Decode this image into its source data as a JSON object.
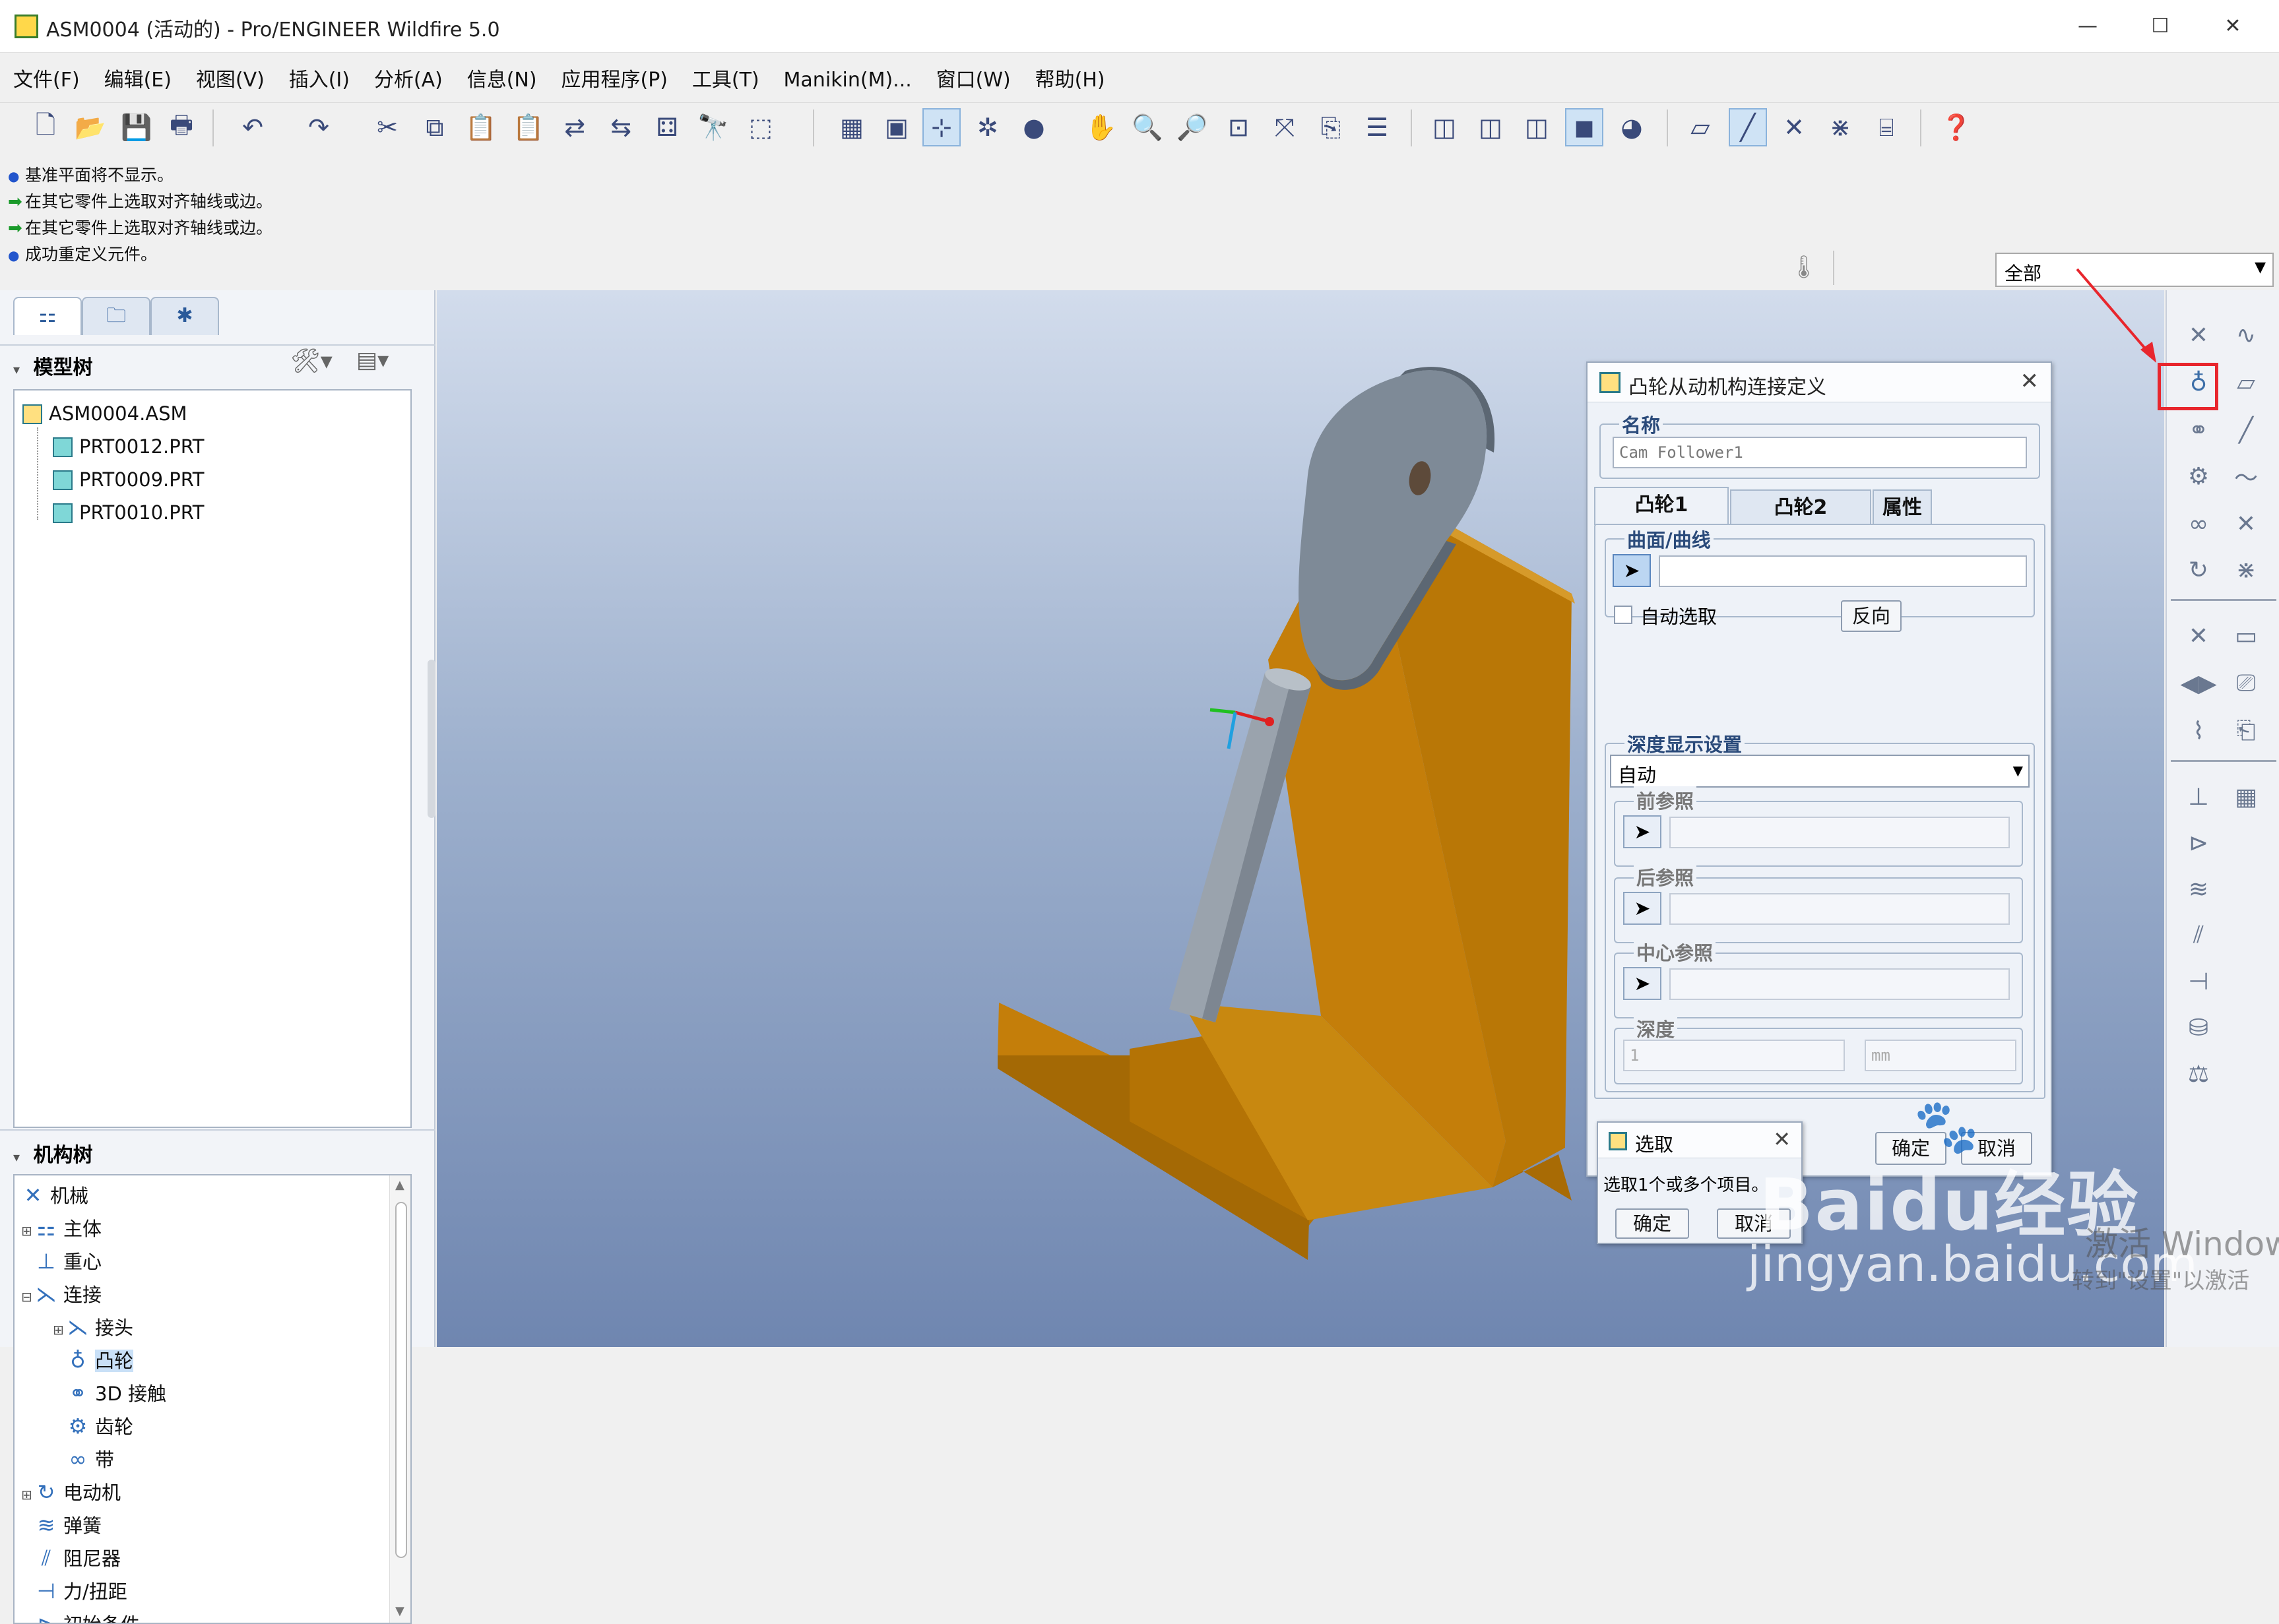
{
  "window": {
    "title": "ASM0004 (活动的) - Pro/ENGINEER Wildfire 5.0",
    "minimize_glyph": "—",
    "maximize_glyph": "☐",
    "close_glyph": "✕"
  },
  "menu": [
    "文件(F)",
    "编辑(E)",
    "视图(V)",
    "插入(I)",
    "分析(A)",
    "信息(N)",
    "应用程序(P)",
    "工具(T)",
    "Manikin(M)...",
    "窗口(W)",
    "帮助(H)"
  ],
  "messages": [
    {
      "kind": "info",
      "text": "基准平面将不显示。"
    },
    {
      "kind": "prompt",
      "text": "在其它零件上选取对齐轴线或边。"
    },
    {
      "kind": "prompt",
      "text": "在其它零件上选取对齐轴线或边。"
    },
    {
      "kind": "info",
      "text": "成功重定义元件。"
    }
  ],
  "filter": {
    "value": "全部"
  },
  "model_tree": {
    "header": "模型树",
    "items": [
      {
        "label": "ASM0004.ASM",
        "icon": "assembly-icon"
      },
      {
        "label": "PRT0012.PRT",
        "icon": "part-icon"
      },
      {
        "label": "PRT0009.PRT",
        "icon": "part-icon"
      },
      {
        "label": "PRT0010.PRT",
        "icon": "part-icon"
      }
    ]
  },
  "mechanism_tree": {
    "header": "机构树",
    "items": [
      {
        "label": "机械",
        "icon": "mechanism-icon",
        "level": 0
      },
      {
        "label": "主体",
        "icon": "body-icon",
        "level": 1
      },
      {
        "label": "重心",
        "icon": "gravity-icon",
        "level": 1
      },
      {
        "label": "连接",
        "icon": "connection-icon",
        "level": 1
      },
      {
        "label": "接头",
        "icon": "joint-icon",
        "level": 2
      },
      {
        "label": "凸轮",
        "icon": "cam-icon",
        "level": 2,
        "selected": true
      },
      {
        "label": "3D 接触",
        "icon": "contact-3d-icon",
        "level": 2
      },
      {
        "label": "齿轮",
        "icon": "gear-icon",
        "level": 2
      },
      {
        "label": "带",
        "icon": "belt-icon",
        "level": 2
      },
      {
        "label": "电动机",
        "icon": "motor-icon",
        "level": 1
      },
      {
        "label": "弹簧",
        "icon": "spring-icon",
        "level": 1
      },
      {
        "label": "阻尼器",
        "icon": "damper-icon",
        "level": 1
      },
      {
        "label": "力/扭距",
        "icon": "force-torque-icon",
        "level": 1
      },
      {
        "label": "初始条件",
        "icon": "initial-condition-icon",
        "level": 1
      }
    ]
  },
  "cam_dialog": {
    "title": "凸轮从动机构连接定义",
    "name_label": "名称",
    "name_value": "Cam Follower1",
    "tabs": [
      "凸轮1",
      "凸轮2",
      "属性"
    ],
    "surface_label": "曲面/曲线",
    "auto_select_label": "自动选取",
    "auto_select_checked": false,
    "flip_button": "反向",
    "depth_settings_label": "深度显示设置",
    "depth_mode": "自动",
    "front_ref_label": "前参照",
    "back_ref_label": "后参照",
    "center_ref_label": "中心参照",
    "depth_label": "深度",
    "depth_value": "1",
    "depth_unit": "mm",
    "ok_button": "确定",
    "cancel_button": "取消"
  },
  "select_dialog": {
    "title": "选取",
    "prompt": "选取1个或多个项目。",
    "ok_button": "确定",
    "cancel_button": "取消"
  },
  "watermark": {
    "logo_text": "Baidu经验",
    "url": "jingyan.baidu.com",
    "activate_line1": "激活 Window",
    "activate_line2": "转到\"设置\"以激活"
  },
  "colors": {
    "viewport_top": "#d2dcec",
    "viewport_bottom": "#6f86b0",
    "bracket": "#c8820a",
    "cam": "#7e8a97",
    "shaft": "#9aa3ad",
    "highlight": "#e8262d"
  }
}
